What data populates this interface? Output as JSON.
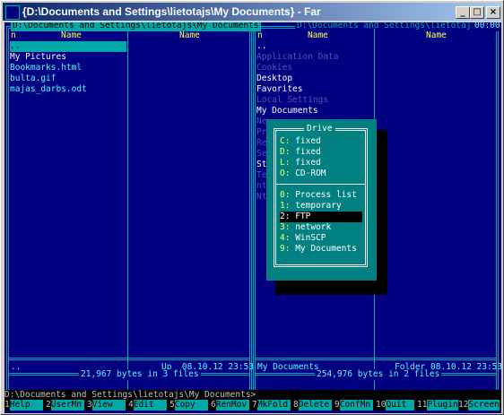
{
  "window": {
    "title": "{D:\\Documents and Settings\\lietotajs\\My Documents} - Far",
    "btn_min": "_",
    "btn_max": "□",
    "btn_close": "×"
  },
  "left_panel": {
    "title": "D:\\Documents and Settings\\lietotajs\\My Documents",
    "col_n": "n",
    "col_name1": "Name",
    "col_name2": "Name",
    "items": [
      {
        "name": "..",
        "kind": "sel"
      },
      {
        "name": "My Pictures",
        "kind": "dir"
      },
      {
        "name": "Bookmarks.html",
        "kind": "file"
      },
      {
        "name": "bulta.gif",
        "kind": "file"
      },
      {
        "name": "majas_darbs.odt",
        "kind": "file"
      }
    ],
    "status_name": "..",
    "status_info": "Up  08.10.12 23:53",
    "summary": "21,967 bytes in 3 files"
  },
  "right_panel": {
    "title": "D:\\Documents and Settings\\lietotajs",
    "clock": "00:00",
    "col_n": "n",
    "col_name1": "Name",
    "col_name2": "Name",
    "items": [
      {
        "name": "..",
        "kind": "dir"
      },
      {
        "name": "Application Data",
        "kind": "hid"
      },
      {
        "name": "Cookies",
        "kind": "hid"
      },
      {
        "name": "Desktop",
        "kind": "dir"
      },
      {
        "name": "Favorites",
        "kind": "dir"
      },
      {
        "name": "Local Settings",
        "kind": "hid"
      },
      {
        "name": "My Documents",
        "kind": "dir"
      },
      {
        "name": "Ne",
        "kind": "hid"
      },
      {
        "name": "Pr",
        "kind": "hid"
      },
      {
        "name": "Re",
        "kind": "hid"
      },
      {
        "name": "Se",
        "kind": "hid"
      },
      {
        "name": "St",
        "kind": "dir"
      },
      {
        "name": "Te",
        "kind": "hid"
      },
      {
        "name": "nt",
        "kind": "hid"
      },
      {
        "name": "Nt",
        "kind": "hid"
      }
    ],
    "status_name": "My Documents",
    "status_info": "Folder 08.10.12 23:53",
    "summary": "254,976 bytes in 2 files"
  },
  "drive_menu": {
    "title": "Drive",
    "drives": [
      {
        "key": "C:",
        "label": "fixed"
      },
      {
        "key": "D:",
        "label": "fixed"
      },
      {
        "key": "L:",
        "label": "fixed"
      },
      {
        "key": "O:",
        "label": "CD-ROM"
      }
    ],
    "plugins": [
      {
        "key": "0:",
        "label": "Process list"
      },
      {
        "key": "1:",
        "label": "temporary"
      },
      {
        "key": "2:",
        "label": "FTP"
      },
      {
        "key": "3:",
        "label": "network"
      },
      {
        "key": "4:",
        "label": "WinSCP"
      },
      {
        "key": "9:",
        "label": "My Documents"
      }
    ],
    "selected_plugin": "2:"
  },
  "command_line": "D:\\Documents and Settings\\lietotajs\\My Documents>",
  "keybar": [
    {
      "num": "1",
      "label": "Help"
    },
    {
      "num": "2",
      "label": "UserMn"
    },
    {
      "num": "3",
      "label": "View"
    },
    {
      "num": "4",
      "label": "Edit"
    },
    {
      "num": "5",
      "label": "Copy"
    },
    {
      "num": "6",
      "label": "RenMov"
    },
    {
      "num": "7",
      "label": "MkFold"
    },
    {
      "num": "8",
      "label": "Delete"
    },
    {
      "num": "9",
      "label": "ConfMn"
    },
    {
      "num": "10",
      "label": "Quit"
    },
    {
      "num": "11",
      "label": "Plugin"
    },
    {
      "num": "12",
      "label": "Screen"
    }
  ]
}
